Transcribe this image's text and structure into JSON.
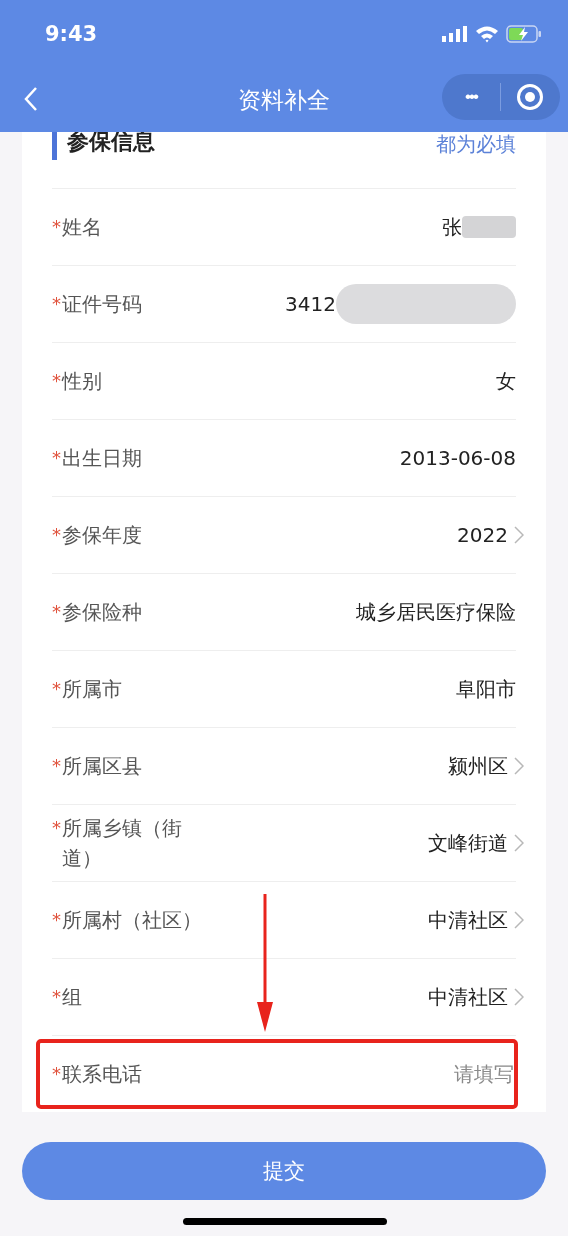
{
  "status_bar": {
    "time": "9:43"
  },
  "nav": {
    "title": "资料补全",
    "menu_button": "•••"
  },
  "section": {
    "title": "参保信息",
    "note": "都为必填"
  },
  "rows": [
    {
      "kind": "text",
      "mark": "*",
      "label": "姓名",
      "value": "张",
      "redacted": true
    },
    {
      "kind": "text",
      "mark": "*",
      "label": "证件号码",
      "value": "3412",
      "redacted": true
    },
    {
      "kind": "text",
      "mark": "*",
      "label": "性别",
      "value": "女"
    },
    {
      "kind": "text",
      "mark": "*",
      "label": "出生日期",
      "value": "2013-06-08"
    },
    {
      "kind": "select",
      "mark": "*",
      "label": "参保年度",
      "value": "2022"
    },
    {
      "kind": "text",
      "mark": "*",
      "label": "参保险种",
      "value": "城乡居民医疗保险"
    },
    {
      "kind": "text",
      "mark": "*",
      "label": "所属市",
      "value": "阜阳市"
    },
    {
      "kind": "select",
      "mark": "*",
      "label": "所属区县",
      "value": "颍州区"
    },
    {
      "kind": "select",
      "mark": "*",
      "label": "所属乡镇（街道）",
      "value": "文峰街道"
    },
    {
      "kind": "select",
      "mark": "*",
      "label": "所属村（社区）",
      "value": "中清社区"
    },
    {
      "kind": "select",
      "mark": "*",
      "label": "组",
      "value": "中清社区"
    },
    {
      "kind": "input",
      "mark": "*",
      "label": "联系电话",
      "placeholder": "请填写",
      "highlighted": true
    }
  ],
  "submit_button": "提交"
}
